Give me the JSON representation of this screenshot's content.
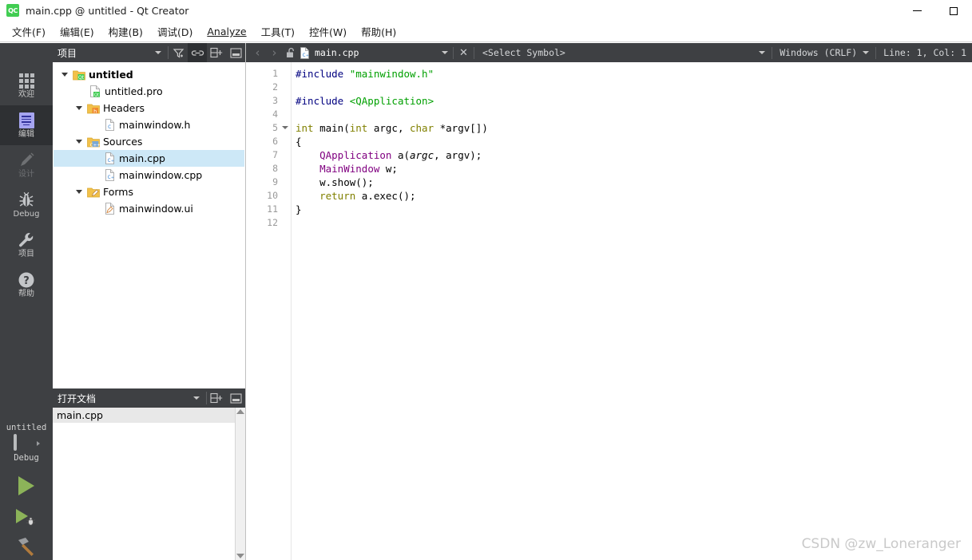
{
  "window": {
    "title": "main.cpp @ untitled - Qt Creator",
    "logo_text": "QC",
    "controls": [
      {
        "name": "minimize-button",
        "label": "—"
      },
      {
        "name": "maximize-button",
        "label": "□"
      }
    ]
  },
  "menubar": {
    "items": [
      {
        "label": "文件(F)",
        "mnemonic": "F"
      },
      {
        "label": "编辑(E)",
        "mnemonic": "E"
      },
      {
        "label": "构建(B)",
        "mnemonic": "B"
      },
      {
        "label": "调试(D)",
        "mnemonic": "D"
      },
      {
        "label": "Analyze",
        "mnemonic": "A"
      },
      {
        "label": "工具(T)",
        "mnemonic": "T"
      },
      {
        "label": "控件(W)",
        "mnemonic": "W"
      },
      {
        "label": "帮助(H)",
        "mnemonic": "H"
      }
    ]
  },
  "modebar": {
    "items": [
      {
        "label": "欢迎",
        "icon": "grid-icon",
        "state": "normal"
      },
      {
        "label": "编辑",
        "icon": "document-icon",
        "state": "active"
      },
      {
        "label": "设计",
        "icon": "pencil-icon",
        "state": "disabled"
      },
      {
        "label": "Debug",
        "icon": "bug-icon",
        "state": "normal"
      },
      {
        "label": "项目",
        "icon": "wrench-icon",
        "state": "normal"
      },
      {
        "label": "帮助",
        "icon": "question-mark-icon",
        "state": "normal"
      }
    ]
  },
  "kit_selector": {
    "project_name": "untitled",
    "build_config": "Debug",
    "run_button": "run-button",
    "debug_button": "debug-button",
    "build_button": "build-button"
  },
  "project_panel": {
    "title": "项目",
    "buttons": [
      {
        "name": "filter-dropdown-button",
        "icon": "chevron-down-icon",
        "active": false
      },
      {
        "name": "filter-tree-button",
        "icon": "filter-icon",
        "active": false
      },
      {
        "name": "sync-with-editor-button",
        "icon": "link-icon",
        "active": true
      },
      {
        "name": "split-button",
        "icon": "split-icon",
        "active": false
      },
      {
        "name": "close-panel-button",
        "icon": "minimize-panel-icon",
        "active": false
      }
    ],
    "tree": [
      {
        "label": "untitled",
        "depth": 0,
        "icon": "qt-project-folder-icon",
        "expanded": true,
        "bold": true,
        "selected": false
      },
      {
        "label": "untitled.pro",
        "depth": 1,
        "icon": "qt-pro-file-icon",
        "expanded": null,
        "bold": false,
        "selected": false
      },
      {
        "label": "Headers",
        "depth": 1,
        "icon": "headers-folder-icon",
        "expanded": true,
        "bold": false,
        "selected": false
      },
      {
        "label": "mainwindow.h",
        "depth": 2,
        "icon": "header-file-icon",
        "expanded": null,
        "bold": false,
        "selected": false
      },
      {
        "label": "Sources",
        "depth": 1,
        "icon": "sources-folder-icon",
        "expanded": true,
        "bold": false,
        "selected": false
      },
      {
        "label": "main.cpp",
        "depth": 2,
        "icon": "cpp-file-icon",
        "expanded": null,
        "bold": false,
        "selected": true
      },
      {
        "label": "mainwindow.cpp",
        "depth": 2,
        "icon": "cpp-file-icon",
        "expanded": null,
        "bold": false,
        "selected": false
      },
      {
        "label": "Forms",
        "depth": 1,
        "icon": "forms-folder-icon",
        "expanded": true,
        "bold": false,
        "selected": false
      },
      {
        "label": "mainwindow.ui",
        "depth": 2,
        "icon": "ui-file-icon",
        "expanded": null,
        "bold": false,
        "selected": false
      }
    ]
  },
  "open_documents_panel": {
    "title": "打开文档",
    "buttons": [
      {
        "name": "opendocs-dropdown-button",
        "icon": "chevron-down-icon"
      },
      {
        "name": "opendocs-split-button",
        "icon": "split-icon"
      },
      {
        "name": "opendocs-close-button",
        "icon": "minimize-panel-icon"
      }
    ],
    "documents": [
      {
        "label": "main.cpp",
        "selected": true
      }
    ]
  },
  "editor_toolbar": {
    "back_button": "‹",
    "forward_button": "›",
    "lock_icon": "unlocked-icon",
    "file_icon": "cpp-file-icon",
    "document_name": "main.cpp",
    "close_button": "✕",
    "symbol_selector": "<Select Symbol>",
    "line_ending": "Windows (CRLF)",
    "cursor_position": "Line: 1, Col: 1"
  },
  "editor": {
    "line_numbers": [
      "1",
      "2",
      "3",
      "4",
      "5",
      "6",
      "7",
      "8",
      "9",
      "10",
      "11",
      "12"
    ],
    "fold_marker_line": 5,
    "lines": [
      [
        {
          "t": "#include ",
          "c": "pp"
        },
        {
          "t": "\"mainwindow.h\"",
          "c": "str"
        }
      ],
      [],
      [
        {
          "t": "#include ",
          "c": "pp"
        },
        {
          "t": "<QApplication>",
          "c": "str"
        }
      ],
      [],
      [
        {
          "t": "int",
          "c": "kw"
        },
        {
          "t": " main(",
          "c": "plain"
        },
        {
          "t": "int",
          "c": "kw"
        },
        {
          "t": " argc, ",
          "c": "plain"
        },
        {
          "t": "char",
          "c": "kw"
        },
        {
          "t": " *argv[])",
          "c": "plain"
        }
      ],
      [
        {
          "t": "{",
          "c": "plain"
        }
      ],
      [
        {
          "t": "    ",
          "c": "plain"
        },
        {
          "t": "QApplication",
          "c": "type"
        },
        {
          "t": " a(",
          "c": "plain"
        },
        {
          "t": "argc",
          "c": "param"
        },
        {
          "t": ", argv);",
          "c": "plain"
        }
      ],
      [
        {
          "t": "    ",
          "c": "plain"
        },
        {
          "t": "MainWindow",
          "c": "type"
        },
        {
          "t": " w;",
          "c": "plain"
        }
      ],
      [
        {
          "t": "    w.show();",
          "c": "plain"
        }
      ],
      [
        {
          "t": "    ",
          "c": "plain"
        },
        {
          "t": "return",
          "c": "kw"
        },
        {
          "t": " a.exec();",
          "c": "plain"
        }
      ],
      [
        {
          "t": "}",
          "c": "plain"
        }
      ],
      []
    ]
  },
  "watermark": {
    "text": "CSDN @zw_Loneranger"
  },
  "colors": {
    "mode_bar_bg": "#3e4043",
    "mode_active_bg": "#2e3033",
    "panel_header_bg": "#3e4043",
    "tree_selection": "#cde8f7",
    "accent_green": "#41cd52",
    "run_green": "#8cb359",
    "kw_olive": "#808000",
    "type_purple": "#800080",
    "string_green": "#00a000",
    "preproc_navy": "#000080"
  }
}
